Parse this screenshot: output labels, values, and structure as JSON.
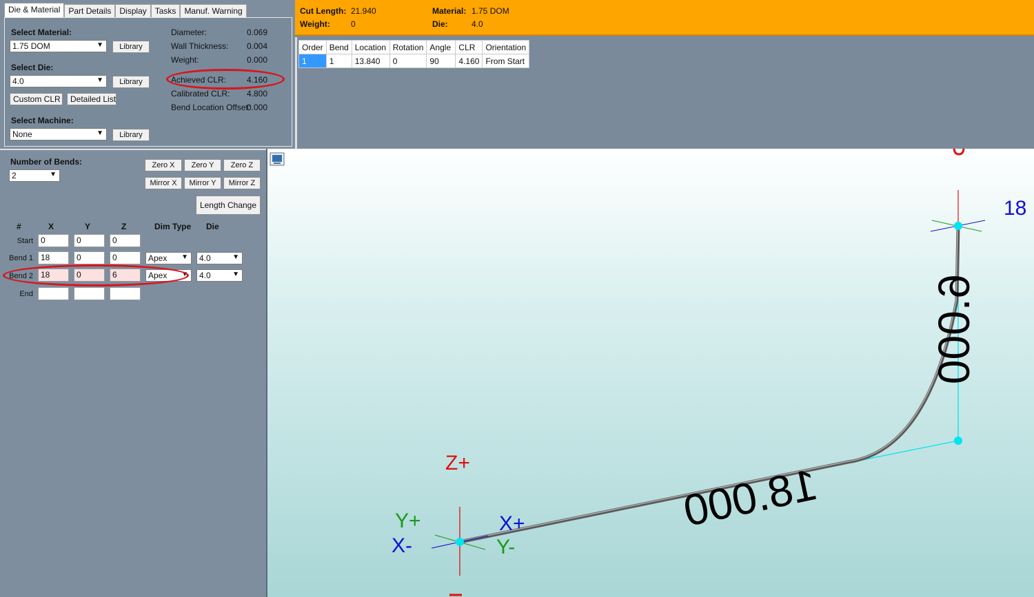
{
  "tabs": [
    "Die & Material",
    "Part Details",
    "Display",
    "Tasks",
    "Manuf. Warning"
  ],
  "die_material": {
    "select_material_label": "Select Material:",
    "material_value": "1.75 DOM",
    "select_die_label": "Select Die:",
    "die_value": "4.0",
    "select_machine_label": "Select Machine:",
    "machine_value": "None",
    "library_label": "Library",
    "custom_clr_label": "Custom CLR",
    "detailed_list_label": "Detailed List",
    "properties": [
      {
        "label": "Diameter:",
        "value": "0.069"
      },
      {
        "label": "Wall Thickness:",
        "value": "0.004"
      },
      {
        "label": "Weight:",
        "value": "0.000"
      },
      {
        "label": "Achieved CLR:",
        "value": "4.160"
      },
      {
        "label": "Calibrated CLR:",
        "value": "4.800"
      },
      {
        "label": "Bend Location Offset:",
        "value": "0.000"
      }
    ]
  },
  "summary": {
    "cut_length_label": "Cut Length:",
    "cut_length_value": "21.940",
    "weight_label": "Weight:",
    "weight_value": "0",
    "material_label": "Material:",
    "material_value": "1.75 DOM",
    "die_label": "Die:",
    "die_value": "4.0"
  },
  "bend_table": {
    "headers": [
      "Order",
      "Bend",
      "Location",
      "Rotation",
      "Angle",
      "CLR",
      "Orientation"
    ],
    "rows": [
      [
        "1",
        "1",
        "13.840",
        "0",
        "90",
        "4.160",
        "From Start"
      ]
    ]
  },
  "editor": {
    "num_bends_label": "Number of Bends:",
    "num_bends_value": "2",
    "buttons": {
      "zero_x": "Zero X",
      "zero_y": "Zero Y",
      "zero_z": "Zero Z",
      "mirror_x": "Mirror X",
      "mirror_y": "Mirror Y",
      "mirror_z": "Mirror Z",
      "length_change": "Length Change"
    },
    "headers": [
      "#",
      "X",
      "Y",
      "Z",
      "Dim Type",
      "Die"
    ],
    "rows": [
      {
        "label": "Start",
        "x": "0",
        "y": "0",
        "z": "0",
        "dim": "",
        "die": ""
      },
      {
        "label": "Bend 1",
        "x": "18",
        "y": "0",
        "z": "0",
        "dim": "Apex",
        "die": "4.0"
      },
      {
        "label": "Bend 2",
        "x": "18",
        "y": "0",
        "z": "6",
        "dim": "Apex",
        "die": "4.0"
      },
      {
        "label": "End",
        "x": "",
        "y": "",
        "z": "",
        "dim": "",
        "die": ""
      }
    ]
  },
  "viewport": {
    "axis_labels": {
      "z_plus": "Z+",
      "y_plus": "Y+",
      "x_plus": "X+",
      "x_minus": "X-",
      "y_minus": "Y-"
    },
    "dimension_1": "18.000",
    "dimension_2": "6.000",
    "corner_label": "18",
    "colors": {
      "z_axis": "#e01010",
      "y_axis": "#1a9a1a",
      "x_axis": "#1010d0",
      "node": "#00e5f0",
      "tube": "#6d6d6d"
    }
  }
}
